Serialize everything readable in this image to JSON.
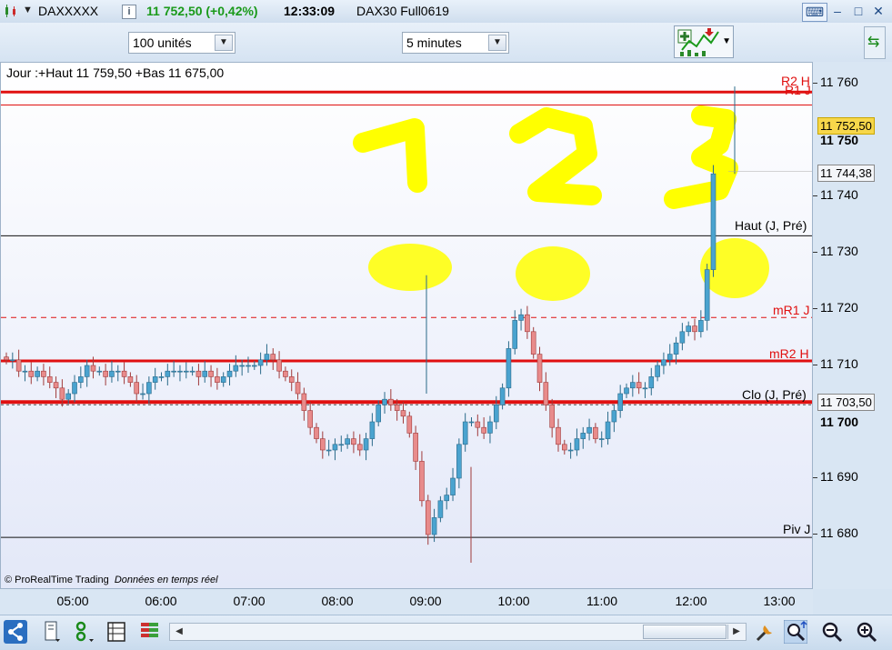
{
  "titlebar": {
    "symbol": "DAXXXXX",
    "price_change": "11 752,50 (+0,42%)",
    "time": "12:33:09",
    "instrument": "DAX30 Full0619",
    "info_label": "i"
  },
  "toolbar": {
    "units_select": "100 unités",
    "interval_select": "5 minutes"
  },
  "chart": {
    "day_label": "Jour :+Haut 11 759,50 +Bas 11 675,00",
    "copyright": "© ProRealTime Trading",
    "data_note": "Données en temps réel",
    "level_labels": {
      "r2h": "R2 H",
      "r1j": "R1 J",
      "haut": "Haut (J, Pré)",
      "mr1j": "mR1 J",
      "mr2h": "mR2 H",
      "clo": "Clo (J, Pré)",
      "piv": "Piv J"
    },
    "annotations": [
      "1",
      "2",
      "3"
    ]
  },
  "axis": {
    "y_ticks": [
      "11 760",
      "11 750",
      "11 740",
      "11 730",
      "11 720",
      "11 710",
      "11 700",
      "11 690",
      "11 680"
    ],
    "last_price": "11 752,50",
    "cursor_price": "11 744,38",
    "close_price": "11 703,50",
    "x_ticks": [
      "05:00",
      "06:00",
      "07:00",
      "08:00",
      "09:00",
      "10:00",
      "11:00",
      "12:00",
      "13:00"
    ]
  },
  "chart_data": {
    "type": "candlestick",
    "y_range": [
      11672,
      11765
    ],
    "levels": {
      "R2 H": 11758.5,
      "R1 J": 11757.5,
      "Haut (J, Pré)": 11733,
      "mR1 J": 11718.5,
      "mR2 H": 11710.8,
      "Clo (J, Pré)": 11703.5,
      "Piv J": 11679.5
    },
    "colors": {
      "up": "#4aa3cf",
      "down": "#e88b8b",
      "level_red": "#e01010",
      "highlight": "#ffff00"
    }
  }
}
